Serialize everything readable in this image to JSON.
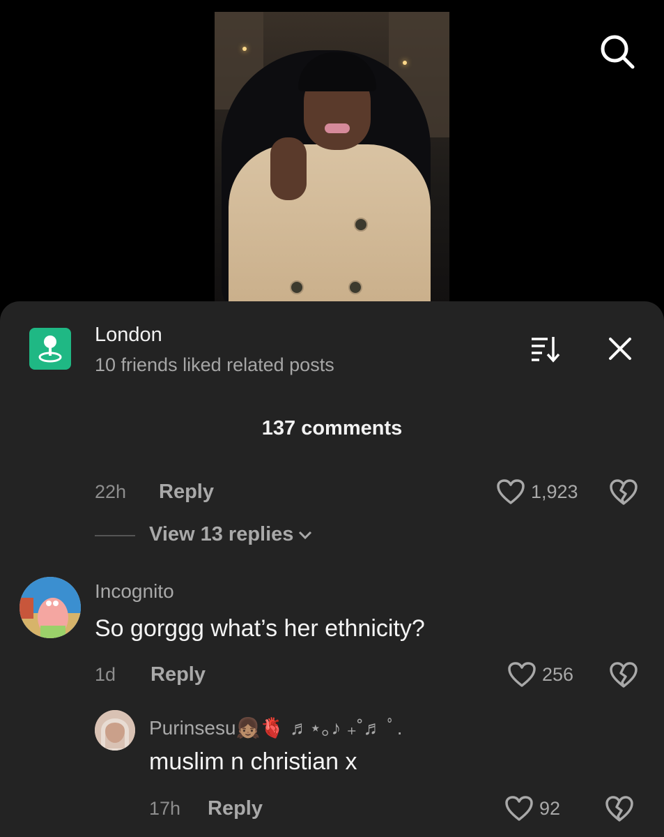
{
  "location": {
    "title": "London",
    "subtitle": "10 friends liked related posts"
  },
  "comments_header": "137 comments",
  "top_comment": {
    "time": "22h",
    "reply_label": "Reply",
    "likes": "1,923",
    "view_replies": "View 13 replies"
  },
  "comment_incognito": {
    "username": "Incognito",
    "text": "So gorggg what’s her ethnicity?",
    "time": "1d",
    "reply_label": "Reply",
    "likes": "256"
  },
  "reply_purinsesu": {
    "username": "Purinsesu👧🏽🫀 ♬⋆｡♪ ₊˚♬ ﾟ.",
    "text": "muslim n christian x",
    "time": "17h",
    "reply_label": "Reply",
    "likes": "92"
  },
  "colors": {
    "panel_bg": "#232323",
    "location_icon_bg": "#1fb884",
    "secondary_text": "#a9a9a9"
  },
  "icons": [
    "search-icon",
    "location-pin-icon",
    "sort-icon",
    "close-icon",
    "heart-icon",
    "broken-heart-icon",
    "chevron-down-icon"
  ]
}
